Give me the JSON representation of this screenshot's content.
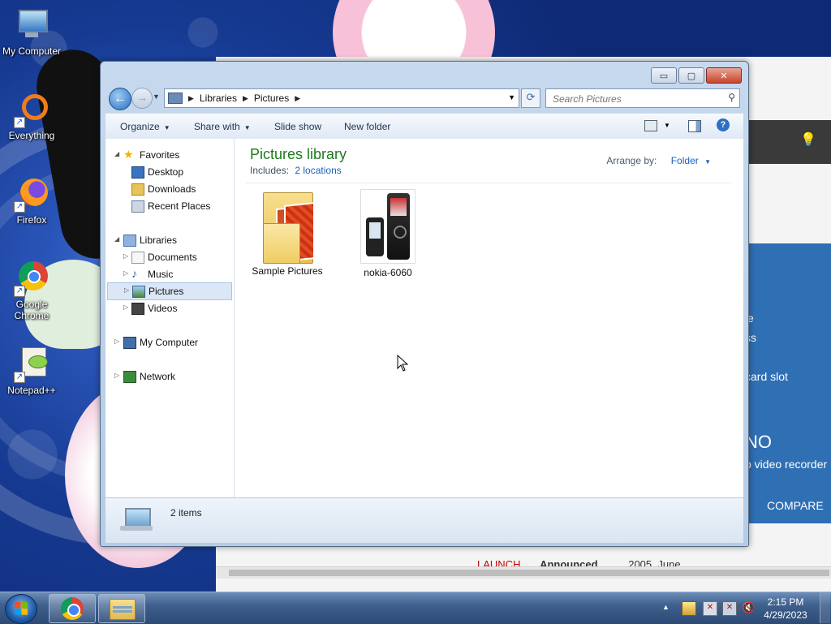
{
  "desktop": {
    "icons": [
      {
        "label": "My Computer",
        "icon": "my-computer-icon"
      },
      {
        "label": "Everything",
        "icon": "everything-icon"
      },
      {
        "label": "Firefox",
        "icon": "firefox-icon"
      },
      {
        "label": "Google Chrome",
        "icon": "chrome-icon"
      },
      {
        "label": "Notepad++",
        "icon": "notepad-plus-plus-icon"
      }
    ],
    "background_page": {
      "spec_lines": [
        "e",
        "ss",
        "card slot",
        "NO",
        "o video recorder"
      ],
      "compare_label": "COMPARE",
      "launch_label": "LAUNCH",
      "announced_label": "Announced",
      "announced_value": "2005, June"
    }
  },
  "window": {
    "controls": {
      "minimize": "▭",
      "maximize": "▢",
      "close": "✕"
    },
    "breadcrumb": [
      "Libraries",
      "Pictures"
    ],
    "search_placeholder": "Search Pictures",
    "toolbar": {
      "organize": "Organize",
      "share_with": "Share with",
      "slide_show": "Slide show",
      "new_folder": "New folder"
    },
    "nav_pane": {
      "favorites": "Favorites",
      "desktop": "Desktop",
      "downloads": "Downloads",
      "recent_places": "Recent Places",
      "libraries": "Libraries",
      "documents": "Documents",
      "music": "Music",
      "pictures": "Pictures",
      "videos": "Videos",
      "my_computer": "My Computer",
      "network": "Network"
    },
    "library": {
      "title": "Pictures library",
      "includes_label": "Includes:",
      "locations_link": "2 locations",
      "arrange_label": "Arrange by:",
      "arrange_value": "Folder"
    },
    "files": [
      {
        "name": "Sample Pictures",
        "type": "folder"
      },
      {
        "name": "nokia-6060",
        "type": "image"
      }
    ],
    "status": {
      "item_count": "2 items"
    }
  },
  "taskbar": {
    "apps": [
      "chrome-icon",
      "windows-explorer-icon"
    ],
    "clock": {
      "time": "2:15 PM",
      "date": "4/29/2023"
    }
  }
}
